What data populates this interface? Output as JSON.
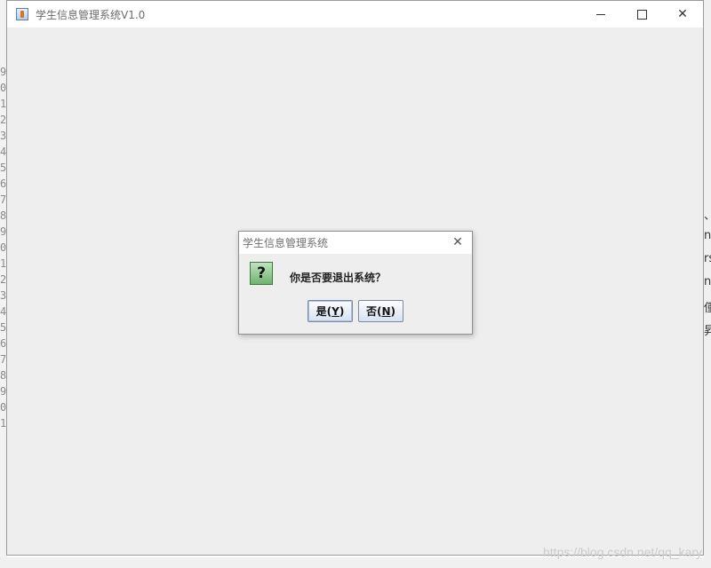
{
  "window": {
    "title": "学生信息管理系统V1.0",
    "controls": {
      "minimize": "—",
      "maximize": "☐",
      "close": "✕"
    }
  },
  "dialog": {
    "title": "学生信息管理系统",
    "close": "✕",
    "icon": "question-icon",
    "icon_glyph": "?",
    "message": "你是否要退出系统？",
    "buttons": {
      "yes": {
        "label": "是",
        "open": "(",
        "mnemonic": "Y",
        "close": ")"
      },
      "no": {
        "label": "否",
        "open": "(",
        "mnemonic": "N",
        "close": ")"
      }
    }
  },
  "background": {
    "line_numbers": [
      "9",
      "0",
      "1",
      "2",
      "3",
      "4",
      "5",
      "6",
      "7",
      "8",
      "9",
      "0",
      "1",
      "2",
      "3",
      "4",
      "5",
      "6",
      "7",
      "8",
      "9",
      "0",
      "1"
    ],
    "right_fragments": [
      "、",
      "nF",
      "rs",
      "n",
      "偅",
      "昇"
    ]
  },
  "watermark": "https://blog.csdn.net/qq_kary",
  "colors": {
    "window_bg": "#eeeeee",
    "titlebar_bg": "#ffffff",
    "question_green": "#6fb36f",
    "button_blue": "#d7e2f0"
  }
}
